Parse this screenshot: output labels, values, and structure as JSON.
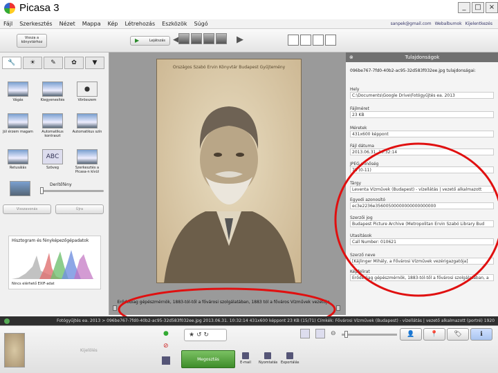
{
  "app": {
    "title": "Picasa 3"
  },
  "window_controls": [
    "_",
    "□",
    "×"
  ],
  "menu": [
    "Fájl",
    "Szerkesztés",
    "Nézet",
    "Mappa",
    "Kép",
    "Létrehozás",
    "Eszközök",
    "Súgó"
  ],
  "account": {
    "email": "sanpek@gmail.com",
    "web": "Webalbumok",
    "signout": "Kijelentkezés"
  },
  "toolbar": {
    "back_label": "Vissza a könyvtárhoz",
    "play_label": "Lejátszás"
  },
  "left_tabs": [
    "wrench-icon",
    "tuning-icon",
    "brush-icon",
    "effects-icon",
    "tint-icon"
  ],
  "tools": [
    {
      "label": "Vágás"
    },
    {
      "label": "Kiegyenesítés"
    },
    {
      "label": "Vörösszem"
    },
    {
      "label": "Jól érzem magam"
    },
    {
      "label": "Automatikus kontraszt"
    },
    {
      "label": "Automatikus szín"
    },
    {
      "label": "Retusálás"
    },
    {
      "label": "Szöveg"
    },
    {
      "label": "Szerkesztés a Picasa-n kívül"
    }
  ],
  "slider_label": "Derítőfény",
  "undo_label": "Visszavonás",
  "redo_label": "Újra",
  "histogram": {
    "title": "Hisztogram és fényképezőgépadatok",
    "note": "Nincs elérhető EXIF-adat"
  },
  "photo": {
    "header": "Országos Szabó Ervin Könyvtár Budapest Gyűjtemény"
  },
  "caption": "Erődediag gépészmérnök, 1883-tól-től a fővárosi szolgálatában, 1883 tól a főváros Vízművek vezetője",
  "properties": {
    "title": "Tulajdonságok",
    "file_id": "096be767-7fd0-40b2-ac95-32d583f032ee.jpg tulajdonságai:",
    "fields": [
      {
        "label": "Hely",
        "value": "C:\\Documents\\Google Drive\\Fotógyűjtés ea. 2013"
      },
      {
        "label": "Fájlméret",
        "value": "23 KB"
      },
      {
        "label": "Méretek",
        "value": "431x600 képpont"
      },
      {
        "label": "Fájl dátuma",
        "value": "2013.06.31. 10:32:14"
      },
      {
        "label": "JPEG minőség",
        "value": "75 (0-11)"
      },
      {
        "label": "Tárgy",
        "value": "Leventa Vízművek (Budapest) - vízellátás | vezető alkalmazott"
      },
      {
        "label": "Egyedi azonosító",
        "value": "ec3e2236e35600500000000000000000"
      },
      {
        "label": "Szerzői jog",
        "value": "Budapest Picture Archive (Metropolitan Ervin Szabó Library Bud"
      },
      {
        "label": "Utasítások",
        "value": "Call Number: 010621"
      },
      {
        "label": "Szerző neve",
        "value": "[Kájlinger Mihály, a Fővárosi Vízművek vezérigazgatója]"
      },
      {
        "label": "Képfelirat",
        "value": "Erődediag gépészmérnök, 1883-tól-től a fővárosi szolgálatában, a"
      }
    ]
  },
  "statusbar": "Fotógyűjtés ea. 2013 > 096be767-7fd0-40b2-ac95-32d583f032ee.jpg   2013.06.31. 10:32:14   431x600 képpont   23 KB   (15/71)   Címkék: Fővárosi Vízművek (Budapest) - vízellátás | vezető alkalmazott (portré) 1920",
  "bottom": {
    "selection_label": "Kijelölés",
    "share_label": "Megosztás",
    "email_label": "E-mail",
    "print_label": "Nyomtatás",
    "export_label": "Exportálás"
  }
}
